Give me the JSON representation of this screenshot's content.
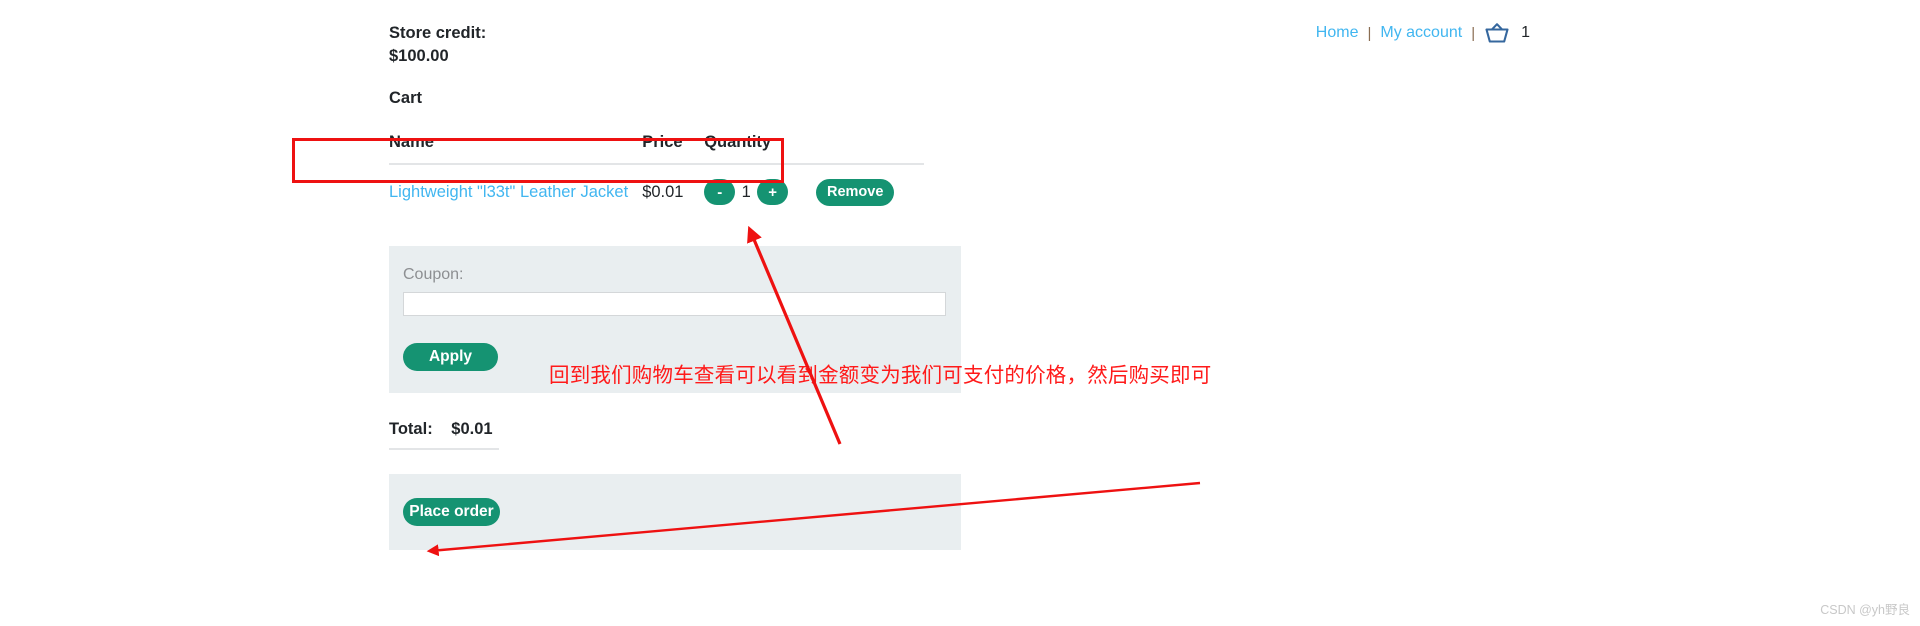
{
  "nav": {
    "home_label": "Home",
    "account_label": "My account",
    "separator": "|",
    "cart_icon": "shopping-basket-icon",
    "cart_count": "1",
    "link_color": "#41b6f0",
    "icon_color": "#35679e"
  },
  "account": {
    "store_credit_label": "Store credit:",
    "store_credit_value": "$100.00"
  },
  "cart": {
    "heading": "Cart",
    "columns": {
      "name": "Name",
      "price": "Price",
      "quantity": "Quantity"
    },
    "rows": [
      {
        "name": "Lightweight \"l33t\" Leather Jacket",
        "price": "$0.01",
        "decrement_label": "-",
        "quantity": "1",
        "increment_label": "+",
        "remove_label": "Remove"
      }
    ]
  },
  "coupon": {
    "label": "Coupon:",
    "value": "",
    "placeholder": "",
    "apply_label": "Apply"
  },
  "totals": {
    "total_label": "Total:",
    "total_value": "$0.01"
  },
  "order": {
    "place_order_label": "Place order"
  },
  "annotation": {
    "text": "回到我们购物车查看可以看到金额变为我们可支付的价格，然后购买即可",
    "color": "#ff1a1a",
    "highlight_box_target": "cart-product-row"
  },
  "watermark": {
    "text": "CSDN @yh野良"
  },
  "theme": {
    "button_green": "#159372",
    "panel_bg": "#e9eef0",
    "text_color": "#212529",
    "muted_label": "#8d8f92"
  }
}
